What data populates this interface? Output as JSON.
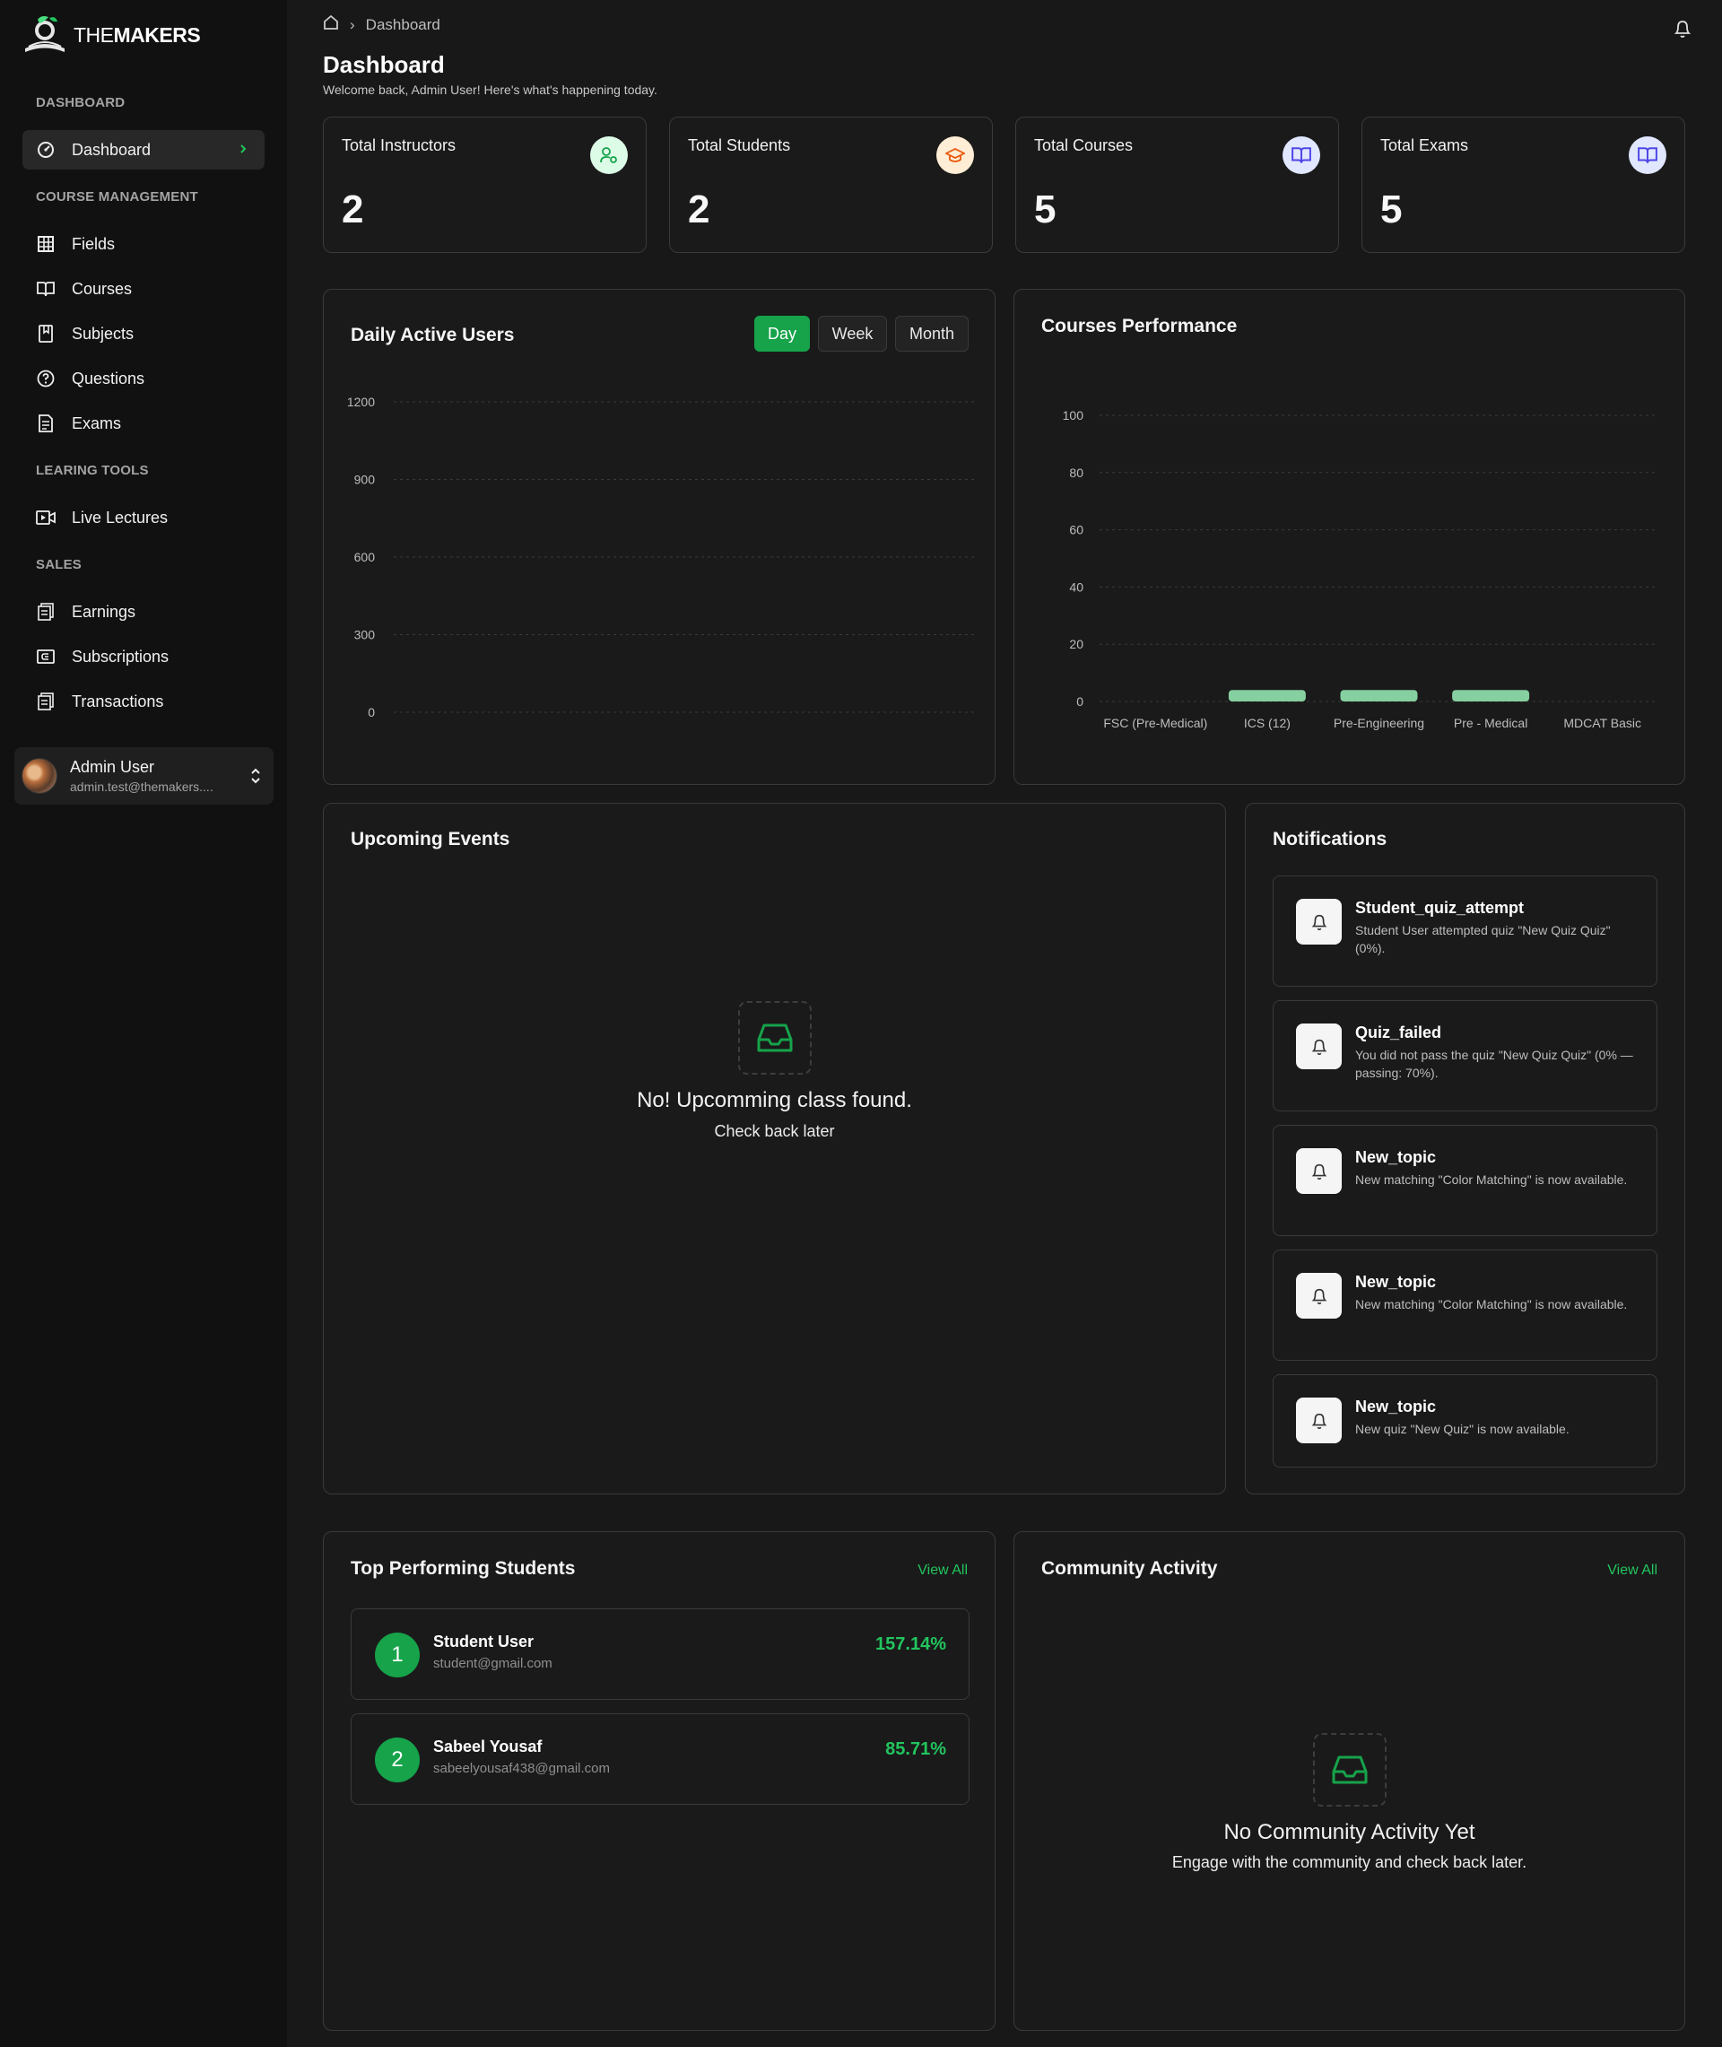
{
  "app": {
    "logo_text_light": "THE",
    "logo_text_bold": "MAKERS",
    "accent_color": "#16a34a"
  },
  "sidebar": {
    "sections": {
      "dashboard": "DASHBOARD",
      "course_management": "COURSE MANAGEMENT",
      "learning_tools": "LEARING TOOLS",
      "sales": "SALES"
    },
    "items": {
      "dashboard": {
        "label": "Dashboard",
        "icon": "gauge-icon"
      },
      "fields": {
        "label": "Fields",
        "icon": "grid-icon"
      },
      "courses": {
        "label": "Courses",
        "icon": "book-open-icon"
      },
      "subjects": {
        "label": "Subjects",
        "icon": "book-bookmark-icon"
      },
      "questions": {
        "label": "Questions",
        "icon": "help-circle-icon"
      },
      "exams": {
        "label": "Exams",
        "icon": "file-text-icon"
      },
      "live_lectures": {
        "label": "Live Lectures",
        "icon": "video-icon"
      },
      "earnings": {
        "label": "Earnings",
        "icon": "receipt-icon"
      },
      "subscriptions": {
        "label": "Subscriptions",
        "icon": "card-icon"
      },
      "transactions": {
        "label": "Transactions",
        "icon": "receipt-icon"
      }
    },
    "user": {
      "name": "Admin User",
      "email": "admin.test@themakers...."
    }
  },
  "header": {
    "breadcrumb_current": "Dashboard",
    "title": "Dashboard",
    "subtitle": "Welcome back, Admin User! Here's what's happening today."
  },
  "stats": [
    {
      "label": "Total Instructors",
      "value": "2",
      "icon": "user-cog-icon",
      "color": "#16a34a",
      "bg": "#dcfce7"
    },
    {
      "label": "Total Students",
      "value": "2",
      "icon": "graduation-cap-icon",
      "color": "#ea580c",
      "bg": "#ffedd5"
    },
    {
      "label": "Total Courses",
      "value": "5",
      "icon": "book-open-icon",
      "color": "#4f46e5",
      "bg": "#e0e7ff"
    },
    {
      "label": "Total Exams",
      "value": "5",
      "icon": "book-open-icon",
      "color": "#4f46e5",
      "bg": "#e0e7ff"
    }
  ],
  "daily_active_users": {
    "title": "Daily Active Users",
    "ranges": [
      "Day",
      "Week",
      "Month"
    ],
    "selected": "Day"
  },
  "courses_performance": {
    "title": "Courses Performance"
  },
  "chart_data": [
    {
      "type": "line",
      "title": "Daily Active Users",
      "xlabel": "",
      "ylabel": "",
      "yticks": [
        0,
        300,
        600,
        900,
        1200
      ],
      "ylim": [
        0,
        1200
      ],
      "series": [],
      "grid": true
    },
    {
      "type": "bar",
      "title": "Courses Performance",
      "categories": [
        "FSC (Pre-Medical)",
        "ICS (12)",
        "Pre-Engineering",
        "Pre - Medical",
        "MDCAT Basic"
      ],
      "values": [
        0,
        4,
        4,
        4,
        0
      ],
      "yticks": [
        0,
        20,
        40,
        60,
        80,
        100
      ],
      "ylim": [
        0,
        100
      ],
      "bar_color": "#86cfa0",
      "grid": true
    }
  ],
  "upcoming_events": {
    "title": "Upcoming Events",
    "empty_title": "No! Upcomming class found.",
    "empty_sub": "Check back later"
  },
  "notifications": {
    "title": "Notifications",
    "items": [
      {
        "title": "Student_quiz_attempt",
        "desc": "Student User attempted quiz \"New Quiz Quiz\" (0%)."
      },
      {
        "title": "Quiz_failed",
        "desc": "You did not pass the quiz \"New Quiz Quiz\" (0% — passing: 70%)."
      },
      {
        "title": "New_topic",
        "desc": "New matching \"Color Matching\" is now available."
      },
      {
        "title": "New_topic",
        "desc": "New matching \"Color Matching\" is now available."
      },
      {
        "title": "New_topic",
        "desc": "New quiz \"New Quiz\" is now available."
      }
    ]
  },
  "top_students": {
    "title": "Top Performing Students",
    "view_all": "View All",
    "items": [
      {
        "rank": "1",
        "name": "Student User",
        "email": "student@gmail.com",
        "score": "157.14%"
      },
      {
        "rank": "2",
        "name": "Sabeel Yousaf",
        "email": "sabeelyousaf438@gmail.com",
        "score": "85.71%"
      }
    ]
  },
  "community": {
    "title": "Community Activity",
    "view_all": "View All",
    "empty_title": "No Community Activity Yet",
    "empty_sub": "Engage with the community and check back later."
  }
}
